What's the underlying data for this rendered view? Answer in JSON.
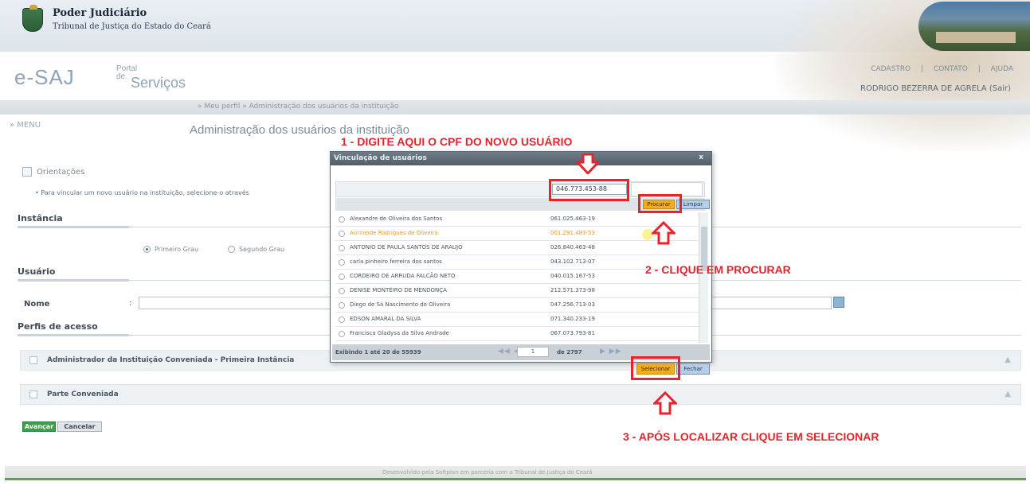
{
  "header": {
    "org_title": "Poder Judiciário",
    "org_subtitle": "Tribunal de Justiça do Estado do Ceará",
    "brand_main": "e-SAJ",
    "brand_portal": "Portal",
    "brand_de": "de",
    "brand_servicos": "Serviços",
    "links": [
      "CADASTRO",
      "|",
      "CONTATO",
      "|",
      "AJUDA"
    ],
    "user_name": "RODRIGO BEZERRA DE AGRELA",
    "user_sair": "(Sair)"
  },
  "breadcrumb": "» Meu perfil » Administração dos usuários da instituição",
  "menu_label": "» MENU",
  "page_title": "Administração dos usuários da instituição",
  "orientacoes": {
    "title": "Orientações",
    "text": "• Para vincular um novo usuário na instituição, selecione-o através"
  },
  "instancia": {
    "label": "Instância",
    "options": [
      "Primeiro Grau",
      "Segundo Grau"
    ],
    "selected": "Primeiro Grau"
  },
  "usuario": {
    "label": "Usuário",
    "nome_label": "Nome",
    "nome_colon": ":",
    "perfis_label": "Perfis de acesso"
  },
  "accordions": [
    {
      "label": "Administrador da Instituição Conveniada - Primeira Instância"
    },
    {
      "label": "Parte Conveniada"
    }
  ],
  "actions": {
    "advance": "Avançar",
    "cancel": "Cancelar"
  },
  "footer": "Desenvolvido pela Softplan em parceria com o Tribunal de Justiça do Ceará",
  "modal": {
    "title": "Vinculação de usuários",
    "close": "x",
    "cpf_value": "046.773.453-88",
    "procurar": "Procurar",
    "limpar": "Limpar",
    "rows": [
      {
        "name": "Alexandre de Oliveira dos Santos",
        "cpf": "061.025.463-19",
        "highlight": false
      },
      {
        "name": "Aurineide Rodrigues de Oliveira",
        "cpf": "001.291.483-53",
        "highlight": true
      },
      {
        "name": "ANTONIO DE PAULA SANTOS DE ARAUJO",
        "cpf": "026.840.463-48",
        "highlight": false
      },
      {
        "name": "carla pinheiro ferreira dos santos",
        "cpf": "043.102.713-07",
        "highlight": false
      },
      {
        "name": "CORDEIRO DE ARRUDA FALCÃO NETO",
        "cpf": "040.015.167-53",
        "highlight": false
      },
      {
        "name": "DENISE MONTEIRO DE MENDONÇA",
        "cpf": "212.571.373-98",
        "highlight": false
      },
      {
        "name": "Diego de Sá Nascimento de Oliveira",
        "cpf": "047.256.713-03",
        "highlight": false
      },
      {
        "name": "EDSON AMARAL DA SILVA",
        "cpf": "071.340.233-19",
        "highlight": false
      },
      {
        "name": "Francisca Gladysa da Silva Andrade",
        "cpf": "067.073.793-81",
        "highlight": false
      }
    ],
    "pager_text": "Exibindo 1 até 20 de 55939",
    "pager_page": "1",
    "pager_of": "de 2797",
    "selecionar": "Selecionar",
    "fechar": "Fechar"
  },
  "annotations": {
    "step1": "1 - DIGITE AQUI O CPF DO NOVO USUÁRIO",
    "step2": "2 - CLIQUE EM PROCURAR",
    "step3": "3 - APÓS LOCALIZAR CLIQUE EM SELECIONAR",
    "color": "#e8232c"
  }
}
